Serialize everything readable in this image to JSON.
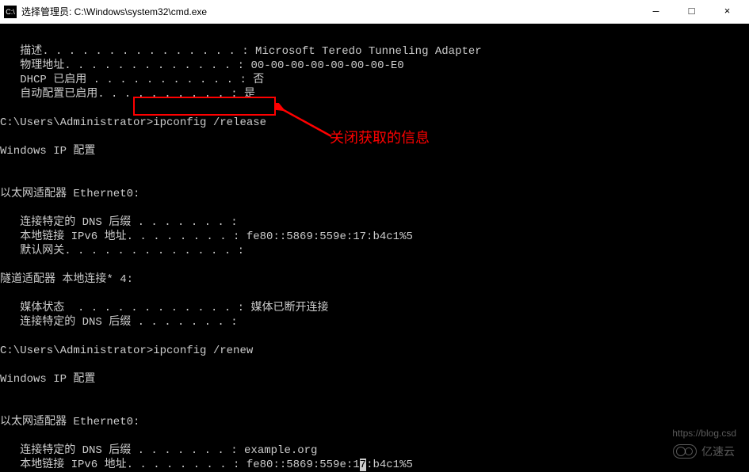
{
  "titlebar": {
    "icon_label": "C:\\",
    "text": "选择管理员: C:\\Windows\\system32\\cmd.exe",
    "minimize": "—",
    "maximize": "□",
    "close": "×"
  },
  "terminal": {
    "line1": "   描述. . . . . . . . . . . . . . . : Microsoft Teredo Tunneling Adapter",
    "line2": "   物理地址. . . . . . . . . . . . . : 00-00-00-00-00-00-00-E0",
    "line3": "   DHCP 已启用 . . . . . . . . . . . : 否",
    "line4": "   自动配置已启用. . . . . . . . . . : 是",
    "line5": "",
    "line6": "C:\\Users\\Administrator>ipconfig /release",
    "line7": "",
    "line8": "Windows IP 配置",
    "line9": "",
    "line10": "",
    "line11": "以太网适配器 Ethernet0:",
    "line12": "",
    "line13": "   连接特定的 DNS 后缀 . . . . . . . :",
    "line14": "   本地链接 IPv6 地址. . . . . . . . : fe80::5869:559e:17:b4c1%5",
    "line15": "   默认网关. . . . . . . . . . . . . :",
    "line16": "",
    "line17": "隧道适配器 本地连接* 4:",
    "line18": "",
    "line19": "   媒体状态  . . . . . . . . . . . . : 媒体已断开连接",
    "line20": "   连接特定的 DNS 后缀 . . . . . . . :",
    "line21": "",
    "line22": "C:\\Users\\Administrator>ipconfig /renew",
    "line23": "",
    "line24": "Windows IP 配置",
    "line25": "",
    "line26": "",
    "line27": "以太网适配器 Ethernet0:",
    "line28": "",
    "line29": "   连接特定的 DNS 后缀 . . . . . . . : example.org",
    "line30a": "   本地链接 IPv6 地址. . . . . . . . : fe80::5869:559e:1",
    "line30b": "7",
    "line30c": ":b4c1%5"
  },
  "annotation": {
    "text": "关闭获取的信息"
  },
  "watermark": {
    "text": "亿速云",
    "blog": "https://blog.csd"
  }
}
